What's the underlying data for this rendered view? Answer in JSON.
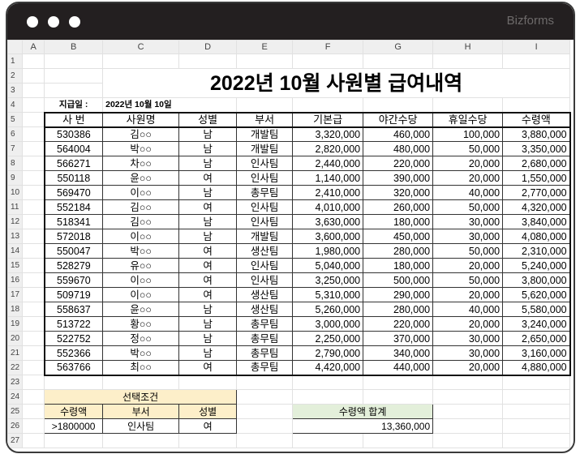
{
  "window": {
    "brand": "Bizforms"
  },
  "columns": [
    "",
    "A",
    "B",
    "C",
    "D",
    "E",
    "F",
    "G",
    "H",
    "I"
  ],
  "title": "2022년 10월 사원별 급여내역",
  "pay_date_label": "지급일 :",
  "pay_date": "2022년 10월 10일",
  "headers": [
    "사 번",
    "사원명",
    "성별",
    "부서",
    "기본급",
    "야간수당",
    "휴일수당",
    "수령액"
  ],
  "rows": [
    [
      "530386",
      "김○○",
      "남",
      "개발팀",
      "3,320,000",
      "460,000",
      "100,000",
      "3,880,000"
    ],
    [
      "564004",
      "박○○",
      "남",
      "개발팀",
      "2,820,000",
      "480,000",
      "50,000",
      "3,350,000"
    ],
    [
      "566271",
      "차○○",
      "남",
      "인사팀",
      "2,440,000",
      "220,000",
      "20,000",
      "2,680,000"
    ],
    [
      "550118",
      "윤○○",
      "여",
      "인사팀",
      "1,140,000",
      "390,000",
      "20,000",
      "1,550,000"
    ],
    [
      "569470",
      "이○○",
      "남",
      "총무팀",
      "2,410,000",
      "320,000",
      "40,000",
      "2,770,000"
    ],
    [
      "552184",
      "김○○",
      "여",
      "인사팀",
      "4,010,000",
      "260,000",
      "50,000",
      "4,320,000"
    ],
    [
      "518341",
      "김○○",
      "남",
      "인사팀",
      "3,630,000",
      "180,000",
      "30,000",
      "3,840,000"
    ],
    [
      "572018",
      "이○○",
      "남",
      "개발팀",
      "3,600,000",
      "450,000",
      "30,000",
      "4,080,000"
    ],
    [
      "550047",
      "박○○",
      "여",
      "생산팀",
      "1,980,000",
      "280,000",
      "50,000",
      "2,310,000"
    ],
    [
      "528279",
      "유○○",
      "여",
      "인사팀",
      "5,040,000",
      "180,000",
      "20,000",
      "5,240,000"
    ],
    [
      "559670",
      "이○○",
      "여",
      "인사팀",
      "3,250,000",
      "500,000",
      "50,000",
      "3,800,000"
    ],
    [
      "509719",
      "이○○",
      "여",
      "생산팀",
      "5,310,000",
      "290,000",
      "20,000",
      "5,620,000"
    ],
    [
      "558637",
      "윤○○",
      "남",
      "생산팀",
      "5,260,000",
      "280,000",
      "40,000",
      "5,580,000"
    ],
    [
      "513722",
      "황○○",
      "남",
      "총무팀",
      "3,000,000",
      "220,000",
      "20,000",
      "3,240,000"
    ],
    [
      "522752",
      "정○○",
      "남",
      "총무팀",
      "2,250,000",
      "370,000",
      "30,000",
      "2,650,000"
    ],
    [
      "552366",
      "박○○",
      "남",
      "총무팀",
      "2,790,000",
      "340,000",
      "30,000",
      "3,160,000"
    ],
    [
      "563766",
      "최○○",
      "여",
      "총무팀",
      "4,420,000",
      "440,000",
      "20,000",
      "4,880,000"
    ]
  ],
  "criteria": {
    "title": "선택조건",
    "headers": [
      "수령액",
      "부서",
      "성별"
    ],
    "values": [
      ">1800000",
      "인사팀",
      "여"
    ]
  },
  "total": {
    "label": "수령액 합계",
    "value": "13,360,000"
  }
}
